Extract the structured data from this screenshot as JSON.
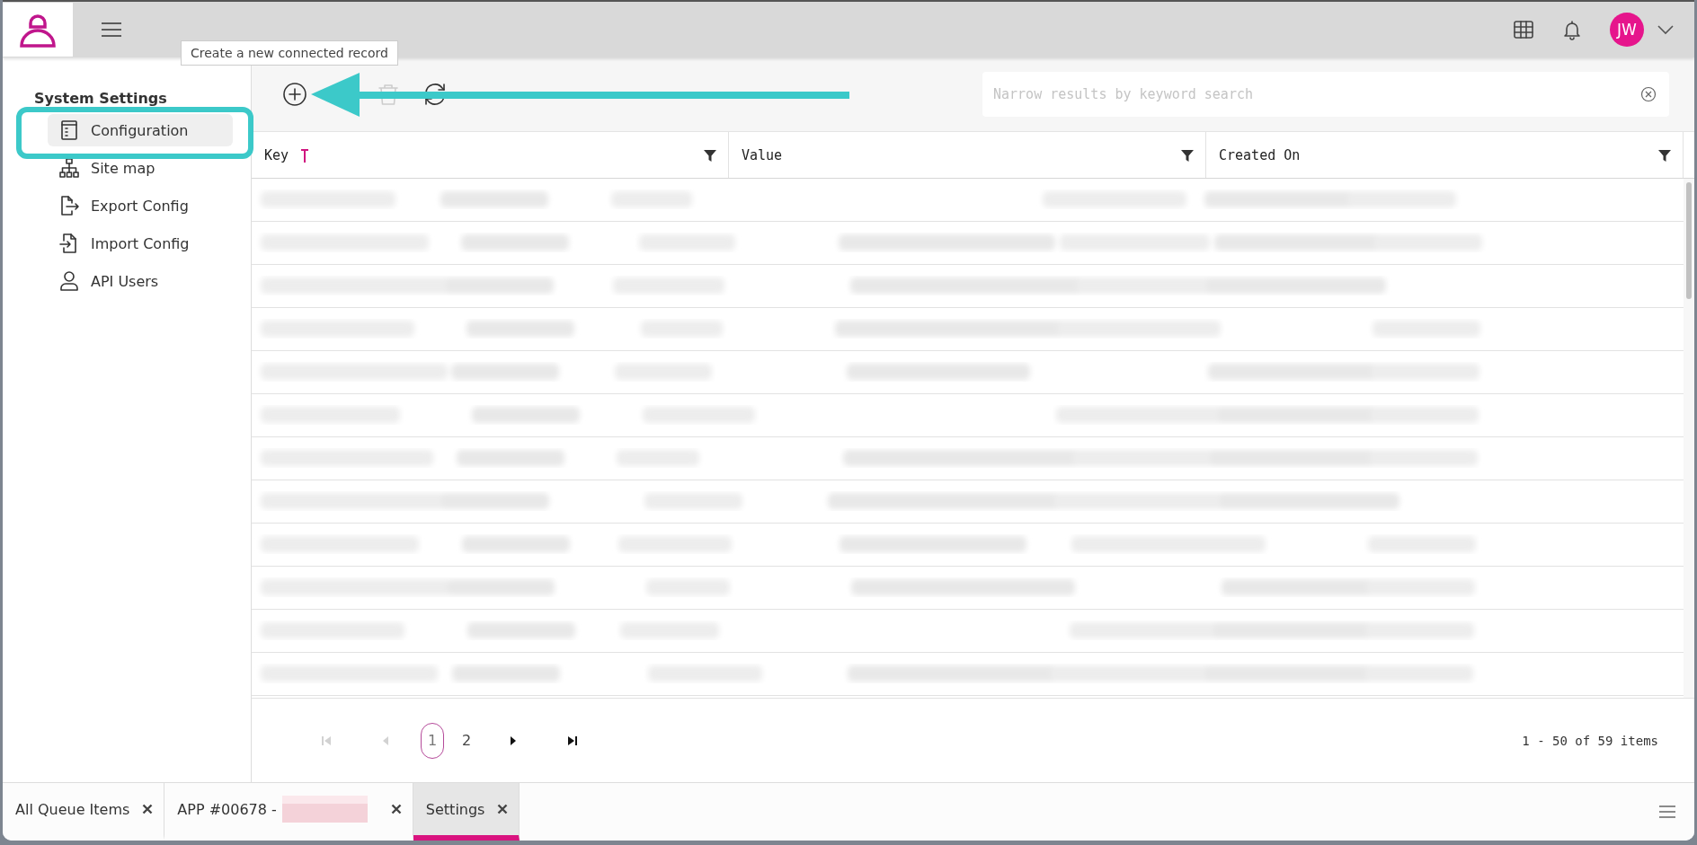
{
  "top_bar": {
    "user": {
      "initials": "JW"
    }
  },
  "tooltip": {
    "text": "Create a new connected record"
  },
  "sidebar": {
    "title": "System Settings",
    "items": [
      {
        "label": "Configuration",
        "kind": "config",
        "selected": true
      },
      {
        "label": "Site map",
        "kind": "sitemap",
        "selected": false
      },
      {
        "label": "Export Config",
        "kind": "export",
        "selected": false
      },
      {
        "label": "Import Config",
        "kind": "import",
        "selected": false
      },
      {
        "label": "API Users",
        "kind": "user",
        "selected": false
      }
    ]
  },
  "toolbar": {
    "buttons": [
      {
        "kind": "add",
        "disabled": false
      },
      {
        "kind": "delete",
        "disabled": true
      },
      {
        "kind": "refresh",
        "disabled": false
      }
    ],
    "search": {
      "placeholder": "Narrow results by keyword search"
    }
  },
  "table": {
    "columns": [
      {
        "label": "Key",
        "sorted": true,
        "filterable": true
      },
      {
        "label": "Value",
        "sorted": false,
        "filterable": true
      },
      {
        "label": "Created On",
        "sorted": false,
        "filterable": true
      }
    ],
    "rows": [
      {
        "blurred": true
      },
      {
        "blurred": true
      },
      {
        "blurred": true
      },
      {
        "blurred": true
      },
      {
        "blurred": true
      },
      {
        "blurred": true
      },
      {
        "blurred": true
      },
      {
        "blurred": true
      },
      {
        "blurred": true
      },
      {
        "blurred": true
      },
      {
        "blurred": true
      },
      {
        "blurred": true
      }
    ]
  },
  "pagination": {
    "pages": [
      {
        "label": "1",
        "selected": true
      },
      {
        "label": "2",
        "selected": false
      }
    ],
    "first_disabled": true,
    "prev_disabled": true,
    "next_disabled": false,
    "last_disabled": false,
    "summary": "1 - 50 of 59 items"
  },
  "bottom_tabs": [
    {
      "label": "All Queue Items",
      "redacted": false,
      "selected": false
    },
    {
      "label": "APP #00678 -",
      "redacted": true,
      "selected": false
    },
    {
      "label": "Settings",
      "redacted": false,
      "selected": true
    }
  ],
  "annotations": {
    "arrow": true,
    "highlight_frame": true
  }
}
